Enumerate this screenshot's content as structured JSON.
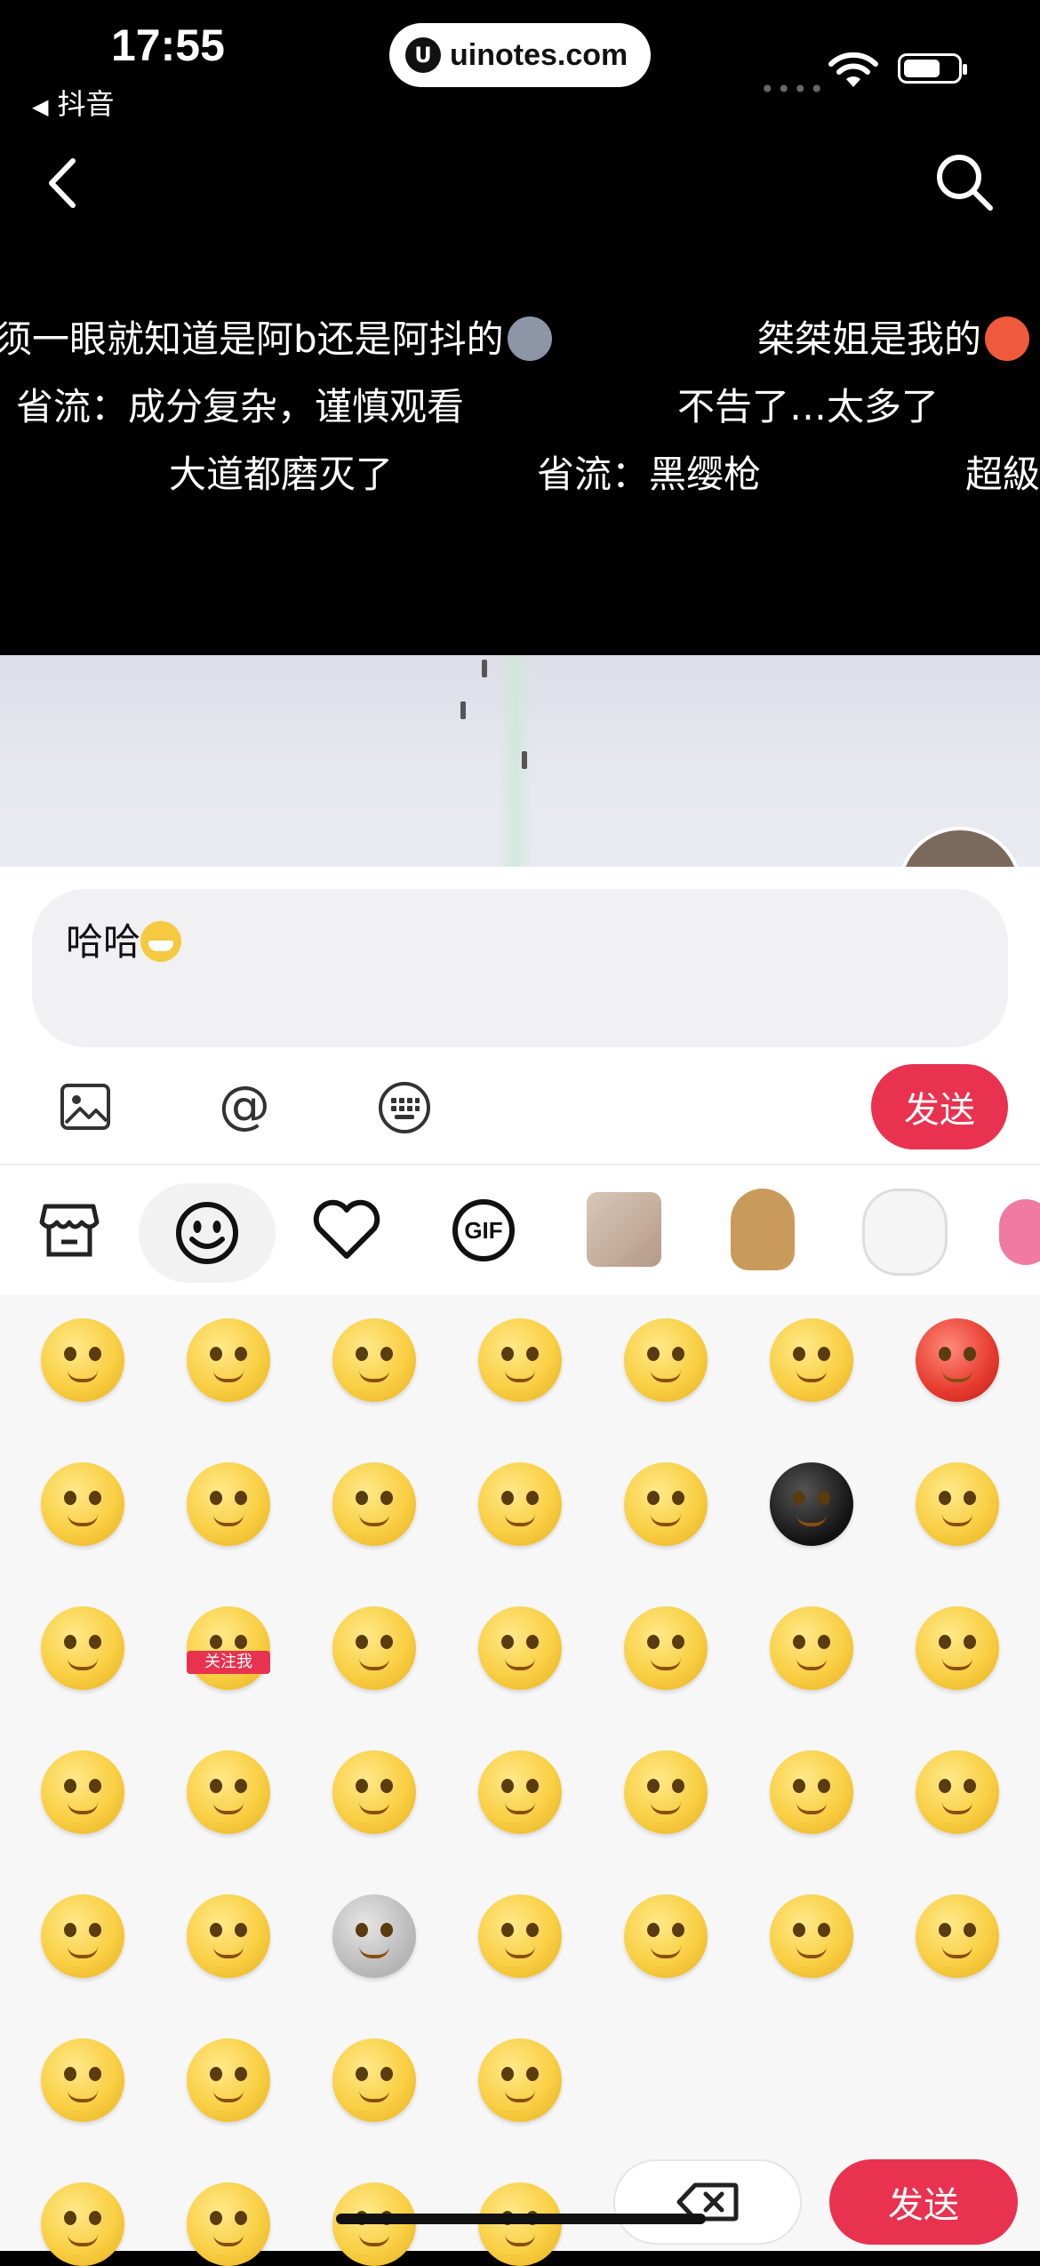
{
  "status_bar": {
    "time": "17:55",
    "back_app": "抖音",
    "url": "uinotes.com"
  },
  "danmaku": [
    "须一眼就知道是阿b还是阿抖的",
    "桀桀姐是我的",
    "省流：成分复杂，谨慎观看",
    "不告了…太多了",
    "大道都磨灭了",
    "省流：黑缨枪",
    "超級"
  ],
  "comment": {
    "text": "哈哈"
  },
  "toolbar": {
    "send_label": "发送"
  },
  "emoji_tabs": [
    "store-icon",
    "smiley-icon",
    "heart-icon",
    "gif-icon",
    "cat-sticker",
    "bear-sticker",
    "dog-sticker",
    "octopus-sticker"
  ],
  "keyboard": {
    "delete_icon": "backspace-icon",
    "send_label": "发送",
    "overlay_label": "关注我"
  },
  "colors": {
    "accent": "#e8324f",
    "emoji_yellow": "#f9cf43"
  }
}
